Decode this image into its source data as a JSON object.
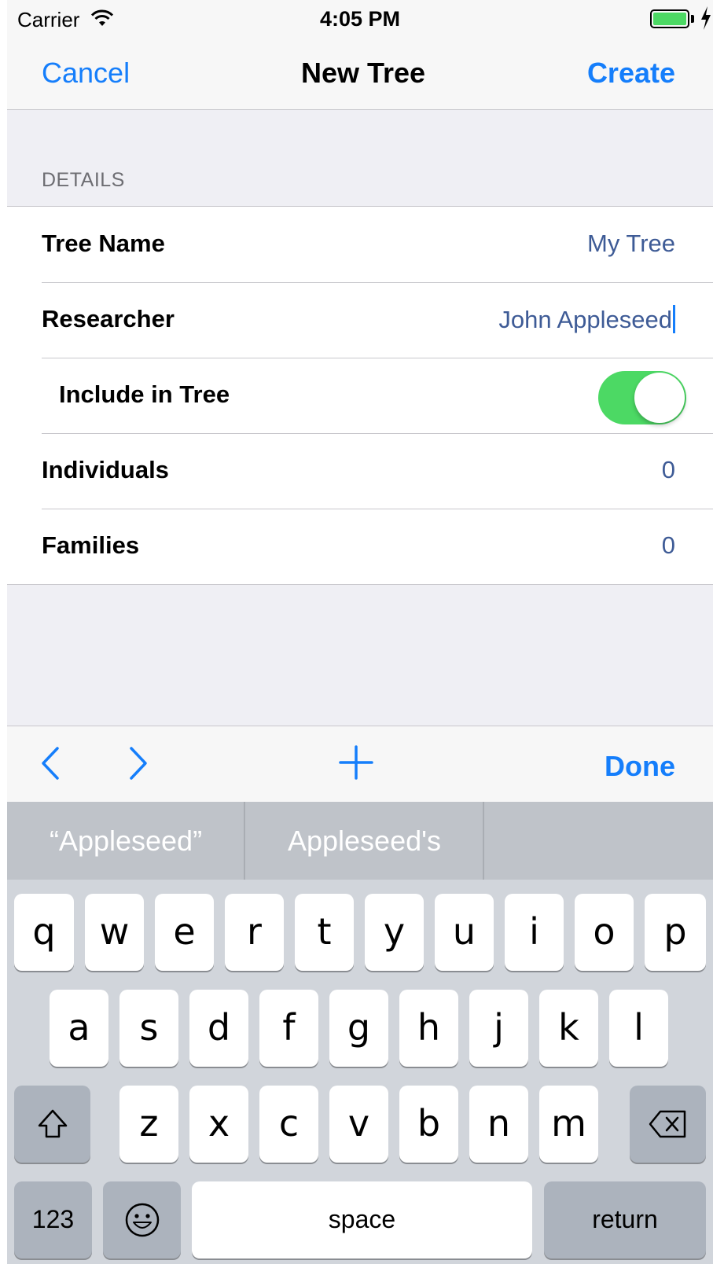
{
  "status_bar": {
    "carrier": "Carrier",
    "time": "4:05 PM",
    "battery_color": "#4cd964"
  },
  "nav": {
    "cancel": "Cancel",
    "title": "New Tree",
    "create": "Create",
    "accent": "#157efb"
  },
  "section": {
    "header": "DETAILS"
  },
  "rows": [
    {
      "label": "Tree Name",
      "value": "My Tree"
    },
    {
      "label": "Researcher",
      "value": "John Appleseed"
    },
    {
      "label": "Include in Tree",
      "toggle_on": true
    },
    {
      "label": "Individuals",
      "value": "0"
    },
    {
      "label": "Families",
      "value": "0"
    }
  ],
  "accessory": {
    "done": "Done",
    "icons": [
      "chevron-left-icon",
      "chevron-right-icon",
      "plus-icon"
    ]
  },
  "suggestions": [
    "“Appleseed”",
    "Appleseed's",
    ""
  ],
  "keyboard": {
    "row1": [
      "q",
      "w",
      "e",
      "r",
      "t",
      "y",
      "u",
      "i",
      "o",
      "p"
    ],
    "row2": [
      "a",
      "s",
      "d",
      "f",
      "g",
      "h",
      "j",
      "k",
      "l"
    ],
    "row3": [
      "z",
      "x",
      "c",
      "v",
      "b",
      "n",
      "m"
    ],
    "numbers": "123",
    "space": "space",
    "return": "return",
    "icons": [
      "shift-icon",
      "delete-icon",
      "emoji-icon"
    ]
  }
}
